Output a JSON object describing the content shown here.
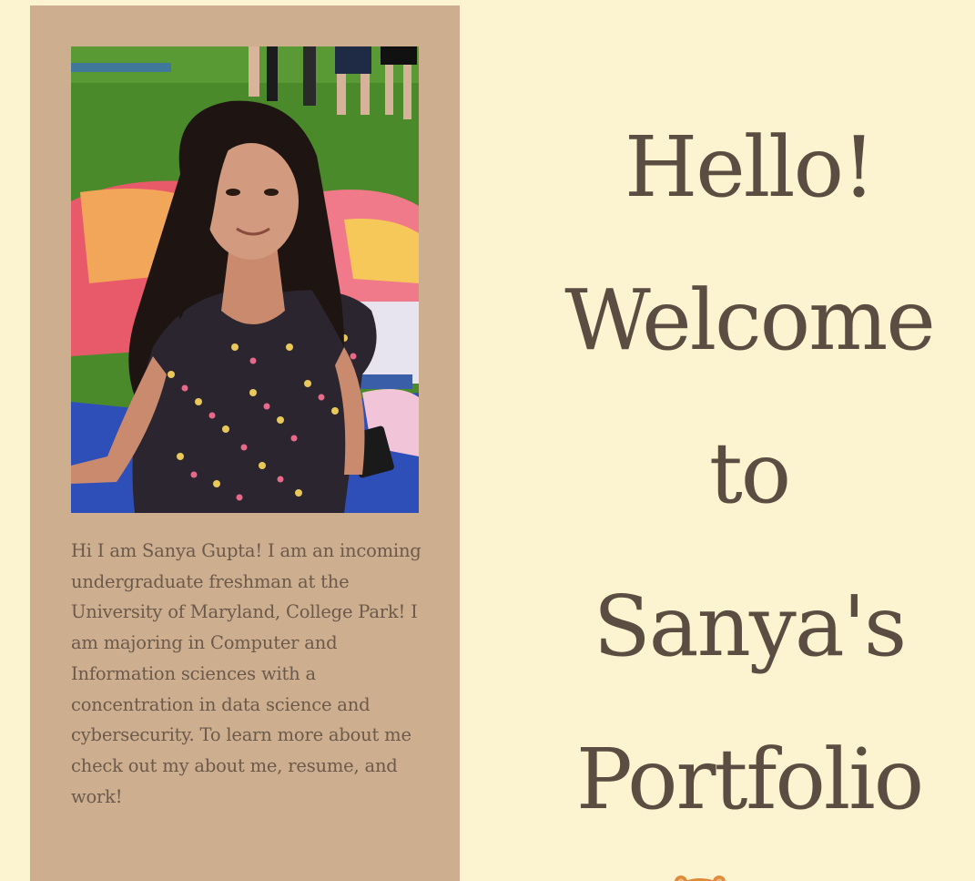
{
  "profile": {
    "photo_alt": "Sanya Gupta",
    "bio": "Hi I am Sanya Gupta! I am an incoming undergraduate freshman at the University of Maryland, College Park! I am majoring in Computer and Information sciences with a concentration in data science and cybersecurity. To learn more about me check out my about me, resume, and work!"
  },
  "hero": {
    "line1": "Hello!",
    "line2": "Welcome",
    "line3": "to",
    "line4": "Sanya's",
    "line5": "Portfolio"
  },
  "colors": {
    "page_background": "#fcf3d0",
    "card_background": "#cdae8f",
    "heading_text": "#5c4d42",
    "bio_text": "#6b5a4c"
  },
  "icons": {
    "bottom_decoration": "bear-icon"
  }
}
